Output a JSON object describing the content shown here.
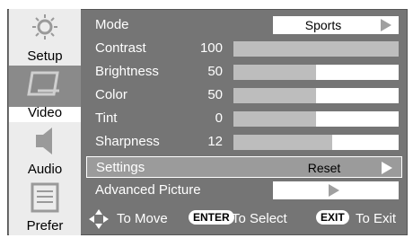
{
  "sidebar": {
    "tabs": [
      {
        "label": "Setup",
        "icon": "sun-icon"
      },
      {
        "label": "Video",
        "icon": "monitor-icon"
      },
      {
        "label": "Audio",
        "icon": "speaker-icon"
      },
      {
        "label": "Prefer",
        "icon": "list-icon"
      }
    ],
    "active_index": 1
  },
  "menu": {
    "mode": {
      "label": "Mode",
      "value": "Sports"
    },
    "sliders": [
      {
        "label": "Contrast",
        "value": "100",
        "fraction": 0.0
      },
      {
        "label": "Brightness",
        "value": "50",
        "fraction": 0.5
      },
      {
        "label": "Color",
        "value": "50",
        "fraction": 0.5
      },
      {
        "label": "Tint",
        "value": "0",
        "fraction": 0.5
      },
      {
        "label": "Sharpness",
        "value": "12",
        "fraction": 0.6
      }
    ],
    "settings": {
      "label": "Settings",
      "value": "Reset"
    },
    "advanced": {
      "label": "Advanced Picture"
    }
  },
  "footer": {
    "move_text": "To Move",
    "enter_key": "ENTER",
    "select_text": "To Select",
    "exit_key": "EXIT",
    "exit_text": "To Exit"
  }
}
